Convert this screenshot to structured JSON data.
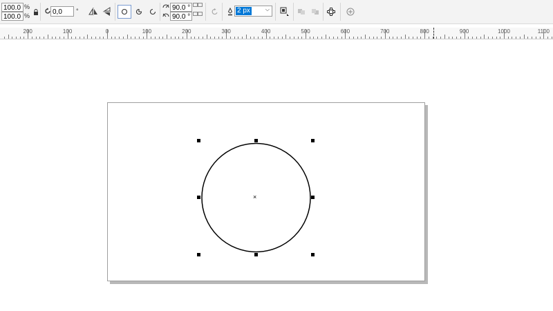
{
  "propertybar": {
    "scale_x": "100.0",
    "scale_y": "100.0",
    "scale_unit": "%",
    "rotation": "0,0",
    "rotation_unit": "°",
    "start_angle": "90.0 °",
    "end_angle": "90.0 °",
    "outline_width": "2 px"
  },
  "icons": {
    "lock": "lock-icon",
    "rotate": "rotate-icon",
    "mirror_h": "mirror-horizontal-icon",
    "mirror_v": "mirror-vertical-icon",
    "ellipse": "ellipse-icon",
    "pie": "pie-icon",
    "arc": "arc-icon",
    "direction": "direction-icon",
    "outline": "outline-pen-icon",
    "wrap": "wrap-text-icon",
    "front": "to-front-icon",
    "back": "to-back-icon",
    "curves": "convert-to-curves-icon",
    "add": "add-preset-icon"
  },
  "ruler": {
    "labels": [
      "200",
      "100",
      "0",
      "100",
      "200",
      "300",
      "400",
      "500",
      "600",
      "700",
      "800",
      "900",
      "1000",
      "1100"
    ]
  },
  "colors": {
    "accent": "#0078d7",
    "page_shadow": "#b8b8b8"
  }
}
